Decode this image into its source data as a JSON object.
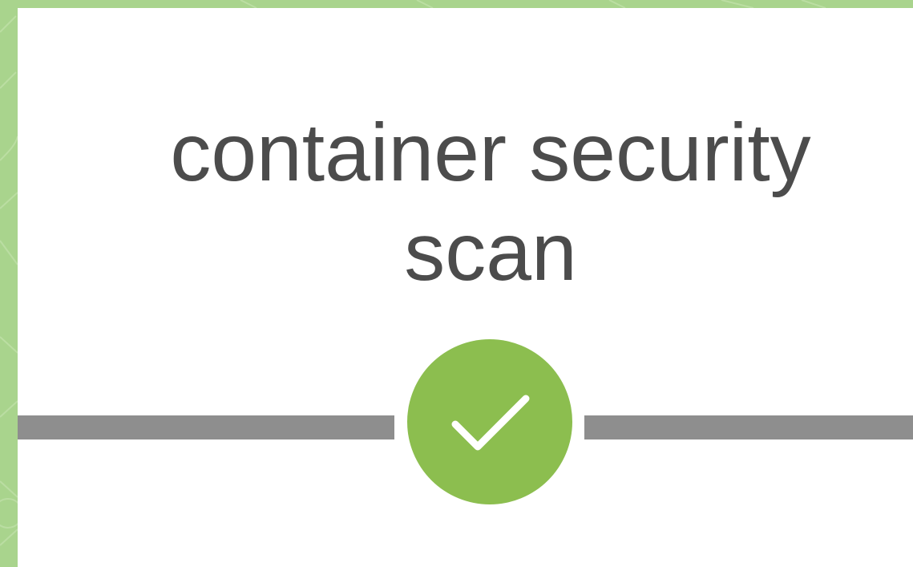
{
  "stage": {
    "title": "container security\nscan",
    "status": "success",
    "status_icon": "checkmark-icon"
  },
  "colors": {
    "background": "#a9d48d",
    "card": "#ffffff",
    "title_text": "#4c4c4c",
    "connector": "#8e8e8e",
    "success": "#8cbe4f"
  }
}
